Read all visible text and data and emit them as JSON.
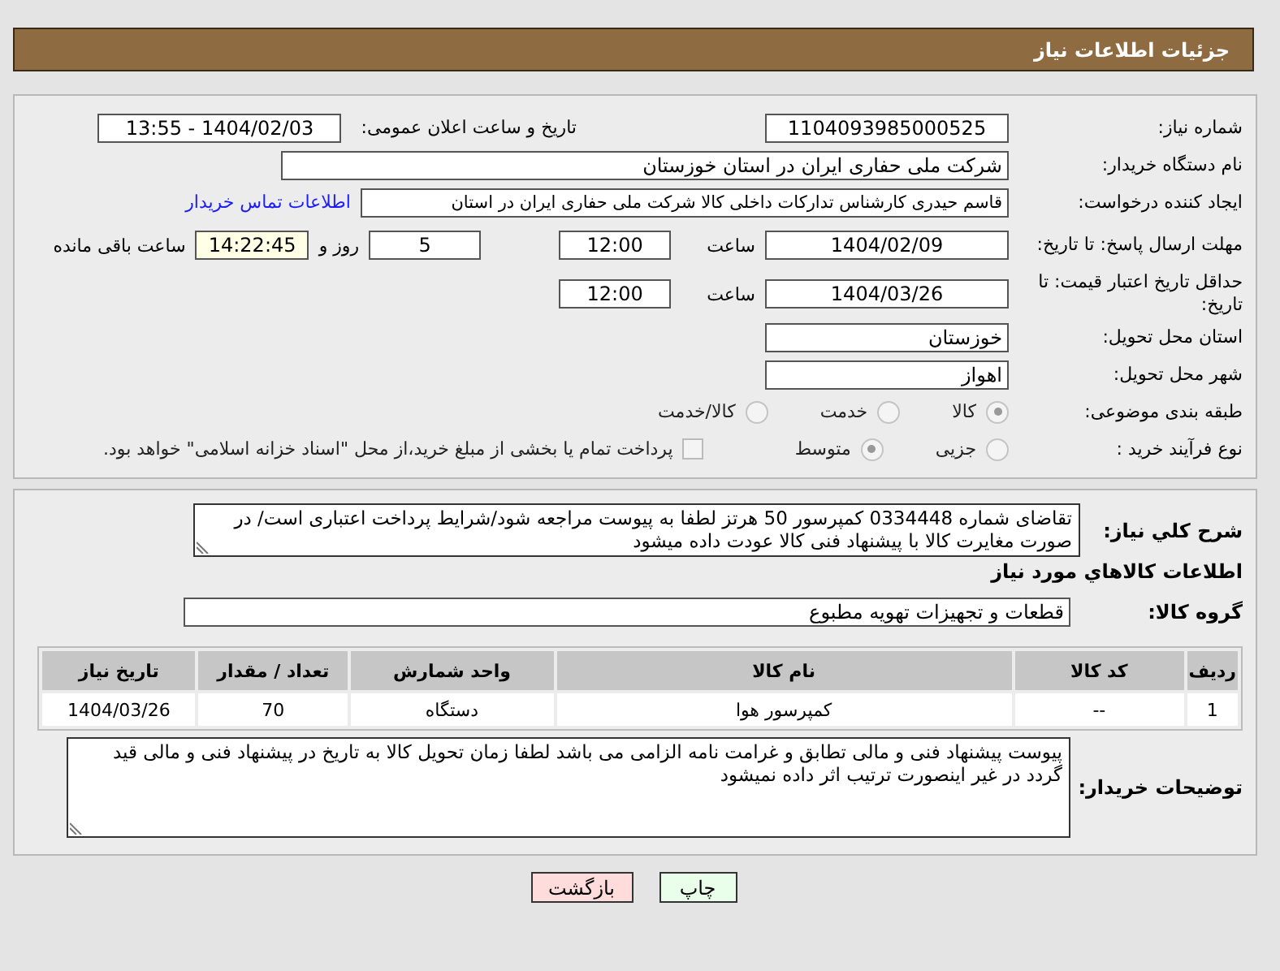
{
  "header": {
    "title": "جزئیات اطلاعات نیاز"
  },
  "need_number": {
    "label": "شماره نیاز:",
    "value": "1104093985000525"
  },
  "announce_datetime": {
    "label": "تاریخ و ساعت اعلان عمومی:",
    "value": "1404/02/03 - 13:55"
  },
  "buyer_org": {
    "label": "نام دستگاه خریدار:",
    "value": "شرکت ملی حفاری ایران در استان خوزستان"
  },
  "requester": {
    "label": "ایجاد کننده درخواست:",
    "value": "قاسم حیدری کارشناس تدارکات داخلی کالا شرکت ملی حفاری ایران در استان",
    "link": "اطلاعات تماس خریدار"
  },
  "reply_deadline": {
    "label": "مهلت ارسال پاسخ: تا تاریخ:",
    "date": "1404/02/09",
    "time_label": "ساعت",
    "time": "12:00",
    "days": "5",
    "days_label": "روز و",
    "remaining": "14:22:45",
    "remaining_label": "ساعت باقی مانده"
  },
  "price_validity": {
    "label": "حداقل تاریخ اعتبار قیمت: تا تاریخ:",
    "date": "1404/03/26",
    "time_label": "ساعت",
    "time": "12:00"
  },
  "delivery_province": {
    "label": "استان محل تحویل:",
    "value": "خوزستان"
  },
  "delivery_city": {
    "label": "شهر محل تحویل:",
    "value": "اهواز"
  },
  "category": {
    "label": "طبقه بندی موضوعی:",
    "options": [
      {
        "label": "کالا",
        "selected": true
      },
      {
        "label": "خدمت",
        "selected": false
      },
      {
        "label": "کالا/خدمت",
        "selected": false
      }
    ]
  },
  "process": {
    "label": "نوع فرآیند خرید :",
    "options": [
      {
        "label": "جزیی",
        "selected": false
      },
      {
        "label": "متوسط",
        "selected": true
      }
    ],
    "treasury": {
      "label": "پرداخت تمام یا بخشی از مبلغ خرید،از محل \"اسناد خزانه اسلامی\" خواهد بود.",
      "checked": false
    }
  },
  "description": {
    "label": "شرح کلي نیاز:",
    "value": "تقاضای شماره 0334448 کمپرسور 50 هرتز لطفا به پیوست مراجعه شود/شرایط پرداخت اعتباری است/ در صورت مغایرت کالا با پیشنهاد فنی کالا عودت داده میشود"
  },
  "goods_heading": "اطلاعات کالاهاي مورد نیاز",
  "goods_group": {
    "label": "گروه کالا:",
    "value": "قطعات و تجهیزات تهویه مطبوع"
  },
  "table": {
    "columns": [
      "ردیف",
      "کد کالا",
      "نام کالا",
      "واحد شمارش",
      "تعداد / مقدار",
      "تاریخ نیاز"
    ],
    "rows": [
      [
        "1",
        "--",
        "کمپرسور هوا",
        "دستگاه",
        "70",
        "1404/03/26"
      ]
    ]
  },
  "buyer_notes": {
    "label": "توضیحات خریدار:",
    "value": "پیوست پیشنهاد فنی و مالی تطابق و غرامت نامه الزامی می باشد لطفا زمان تحویل کالا به تاریخ در پیشنهاد فنی و مالی قید گردد در غیر اینصورت ترتیب اثر داده نمیشود"
  },
  "buttons": [
    {
      "label": "چاپ",
      "kind": "print"
    },
    {
      "label": "بازگشت",
      "kind": "back"
    }
  ]
}
